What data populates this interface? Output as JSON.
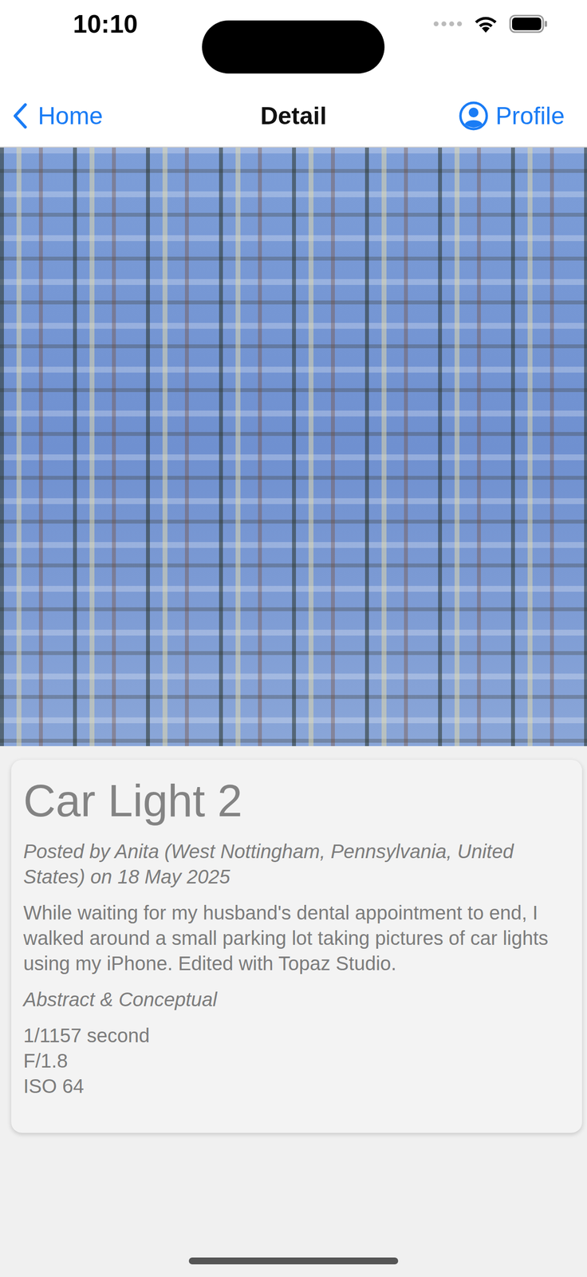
{
  "status_bar": {
    "time": "10:10"
  },
  "nav": {
    "back": "Home",
    "title": "Detail",
    "action": "Profile"
  },
  "post": {
    "title": "Car Light 2",
    "byline": "Posted by Anita (West Nottingham, Pennsylvania, United States) on 18 May 2025",
    "description": "While waiting for my husband's dental appointment to end, I walked around a small parking lot taking pictures of car lights using my iPhone. Edited with Topaz Studio.",
    "category": "Abstract & Conceptual",
    "exif": [
      "1/1157 second",
      "F/1.8",
      "ISO 64"
    ]
  }
}
